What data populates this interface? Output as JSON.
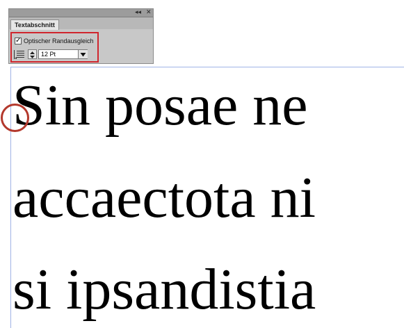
{
  "panel": {
    "tab_label": "Textabschnitt",
    "collapse_glyph": "◂◂",
    "close_glyph": "✕",
    "optical_margin": {
      "checked": true,
      "check_glyph": "✓",
      "label": "Optischer Randausgleich"
    },
    "size_value": "12 Pt",
    "icons": [
      "align-icon",
      "stepper-icon",
      "chevron-down-icon"
    ]
  },
  "document": {
    "lines": [
      "Sin posae ne",
      "accaectota ni",
      "si ipsandistia"
    ]
  },
  "colors": {
    "highlight": "#d0252d",
    "circle": "#b3382c",
    "guide": "#9fb3e6"
  }
}
